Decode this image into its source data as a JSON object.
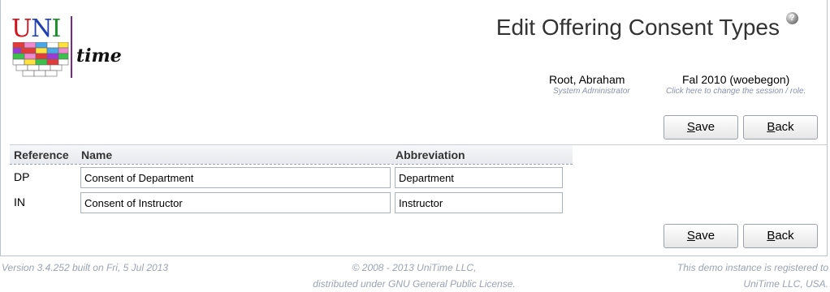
{
  "header": {
    "logo_uni": [
      "U",
      "N",
      "I"
    ],
    "logo_time": "time",
    "title": "Edit Offering Consent Types",
    "help_glyph": "?"
  },
  "user": {
    "name": "Root, Abraham",
    "role": "System Administrator"
  },
  "session": {
    "name": "Fal 2010 (woebegon)",
    "hint": "Click here to change the session / role."
  },
  "buttons": {
    "save": {
      "key": "S",
      "rest": "ave"
    },
    "back": {
      "key": "B",
      "rest": "ack"
    }
  },
  "table": {
    "headers": {
      "reference": "Reference",
      "name": "Name",
      "abbreviation": "Abbreviation"
    },
    "rows": [
      {
        "reference": "DP",
        "name": "Consent of Department",
        "abbreviation": "Department"
      },
      {
        "reference": "IN",
        "name": "Consent of Instructor",
        "abbreviation": "Instructor"
      }
    ]
  },
  "footer": {
    "version": "Version 3.4.252 built on Fri, 5 Jul 2013",
    "copyright_line1": "© 2008 - 2013 UniTime LLC,",
    "copyright_line2": "distributed under GNU General Public License.",
    "registered_line1": "This demo instance is registered to",
    "registered_line2": "UniTime LLC, USA."
  },
  "colors": {
    "accent_text": "#8a93b0",
    "title": "#333333",
    "border": "#b9c4cf"
  }
}
